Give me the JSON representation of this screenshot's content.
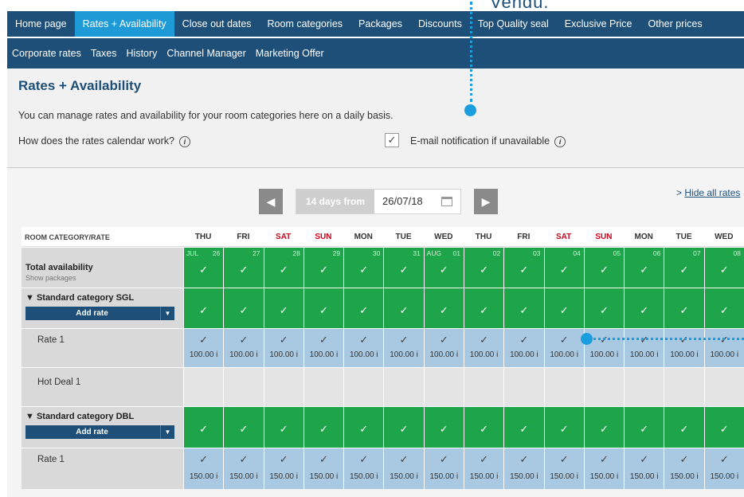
{
  "callout": {
    "label": "Vendu."
  },
  "nav_primary": [
    "Home page",
    "Rates + Availability",
    "Close out dates",
    "Room categories",
    "Packages",
    "Discounts",
    "Top Quality seal",
    "Exclusive Price",
    "Other prices"
  ],
  "nav_secondary": [
    "Corporate rates",
    "Taxes",
    "History",
    "Channel Manager",
    "Marketing Offer"
  ],
  "page": {
    "title": "Rates + Availability",
    "description": "You can manage rates and availability for your room categories here on a daily basis.",
    "howto": "How does the rates calendar work?",
    "email_label": "E-mail notification if unavailable",
    "email_checked": "✓"
  },
  "datebar": {
    "label": "14 days from",
    "date": "26/07/18",
    "hide_all_prefix": ">",
    "hide_all": "Hide all rates"
  },
  "grid": {
    "header_label": "ROOM CATEGORY/RATE",
    "days": [
      "THU",
      "FRI",
      "SAT",
      "SUN",
      "MON",
      "TUE",
      "WED",
      "THU",
      "FRI",
      "SAT",
      "SUN",
      "MON",
      "TUE",
      "WED"
    ],
    "weekend_indexes": [
      2,
      3,
      9,
      10
    ],
    "dates": [
      "26",
      "27",
      "28",
      "29",
      "30",
      "31",
      "01",
      "02",
      "03",
      "04",
      "05",
      "06",
      "07",
      "08"
    ],
    "month_labels": {
      "0": "JUL",
      "6": "AUG"
    },
    "total": {
      "title": "Total availability",
      "sub": "Show packages"
    },
    "cat_sgl": {
      "title": "▼ Standard category SGL",
      "add": "Add rate"
    },
    "rate1_sgl": {
      "name": "Rate 1",
      "price": "100.00 i"
    },
    "hotdeal": {
      "name": "Hot Deal 1"
    },
    "cat_dbl": {
      "title": "▼ Standard category DBL",
      "add": "Add rate"
    },
    "rate1_dbl": {
      "name": "Rate 1",
      "price": "150.00 i"
    }
  },
  "colors": {
    "nav": "#1d4f78",
    "active": "#1e9ad6",
    "green": "#1ea54a",
    "rate_blue": "#a9c9e3",
    "callout": "#1a9ee0"
  }
}
